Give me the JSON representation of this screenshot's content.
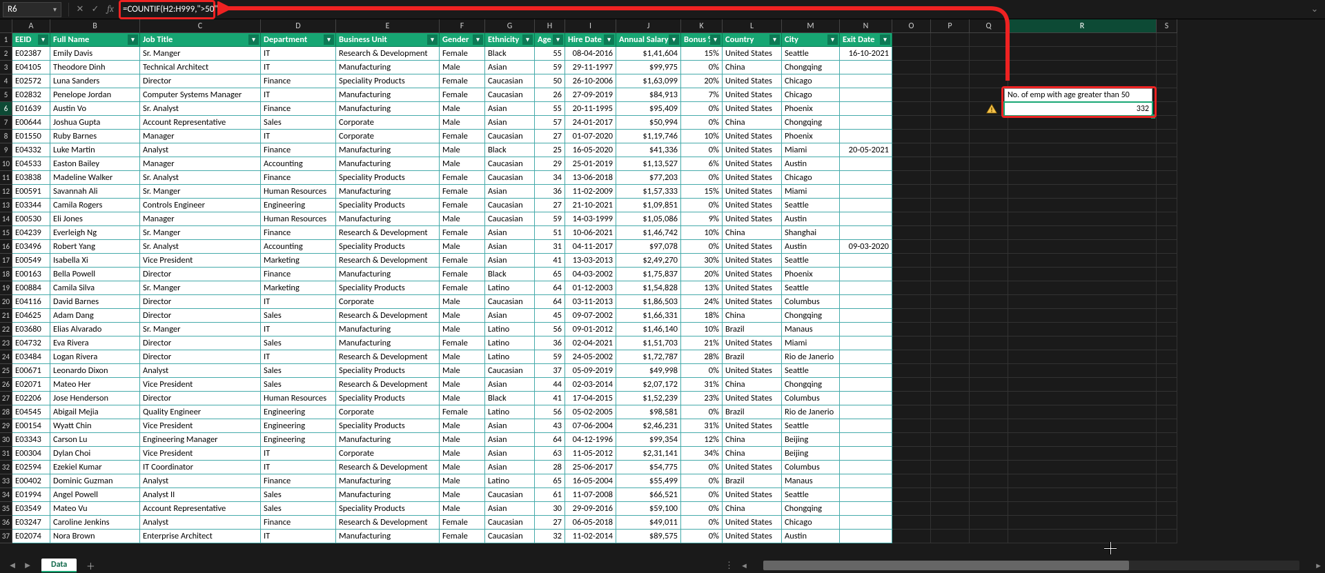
{
  "nameBox": "R6",
  "formula": "=COUNTIF(H2:H999,\">50\")",
  "chart_data": null,
  "columns": [
    "A",
    "B",
    "C",
    "D",
    "E",
    "F",
    "G",
    "H",
    "I",
    "J",
    "K",
    "L",
    "M",
    "N",
    "O",
    "P",
    "Q",
    "R",
    "S"
  ],
  "headers": [
    "EEID",
    "Full Name",
    "Job Title",
    "Department",
    "Business Unit",
    "Gender",
    "Ethnicity",
    "Age",
    "Hire Date",
    "Annual Salary",
    "Bonus %",
    "Country",
    "City",
    "Exit Date"
  ],
  "sideLabel": "No. of emp with age greater than 50",
  "sideResult": "332",
  "sheetTab": "Data",
  "rows": [
    {
      "n": 2,
      "d": [
        "E02387",
        "Emily Davis",
        "Sr. Manger",
        "IT",
        "Research & Development",
        "Female",
        "Black",
        "55",
        "08-04-2016",
        "$1,41,604",
        "15%",
        "United States",
        "Seattle",
        "16-10-2021"
      ]
    },
    {
      "n": 3,
      "d": [
        "E04105",
        "Theodore Dinh",
        "Technical Architect",
        "IT",
        "Manufacturing",
        "Male",
        "Asian",
        "59",
        "29-11-1997",
        "$99,975",
        "0%",
        "China",
        "Chongqing",
        ""
      ]
    },
    {
      "n": 4,
      "d": [
        "E02572",
        "Luna Sanders",
        "Director",
        "Finance",
        "Speciality Products",
        "Female",
        "Caucasian",
        "50",
        "26-10-2006",
        "$1,63,099",
        "20%",
        "United States",
        "Chicago",
        ""
      ]
    },
    {
      "n": 5,
      "d": [
        "E02832",
        "Penelope Jordan",
        "Computer Systems Manager",
        "IT",
        "Manufacturing",
        "Female",
        "Caucasian",
        "26",
        "27-09-2019",
        "$84,913",
        "7%",
        "United States",
        "Chicago",
        ""
      ]
    },
    {
      "n": 6,
      "d": [
        "E01639",
        "Austin Vo",
        "Sr. Analyst",
        "Finance",
        "Manufacturing",
        "Male",
        "Asian",
        "55",
        "20-11-1995",
        "$95,409",
        "0%",
        "United States",
        "Phoenix",
        ""
      ]
    },
    {
      "n": 7,
      "d": [
        "E00644",
        "Joshua Gupta",
        "Account Representative",
        "Sales",
        "Corporate",
        "Male",
        "Asian",
        "57",
        "24-01-2017",
        "$50,994",
        "0%",
        "China",
        "Chongqing",
        ""
      ]
    },
    {
      "n": 8,
      "d": [
        "E01550",
        "Ruby Barnes",
        "Manager",
        "IT",
        "Corporate",
        "Female",
        "Caucasian",
        "27",
        "01-07-2020",
        "$1,19,746",
        "10%",
        "United States",
        "Phoenix",
        ""
      ]
    },
    {
      "n": 9,
      "d": [
        "E04332",
        "Luke Martin",
        "Analyst",
        "Finance",
        "Manufacturing",
        "Male",
        "Black",
        "25",
        "16-05-2020",
        "$41,336",
        "0%",
        "United States",
        "Miami",
        "20-05-2021"
      ]
    },
    {
      "n": 10,
      "d": [
        "E04533",
        "Easton Bailey",
        "Manager",
        "Accounting",
        "Manufacturing",
        "Male",
        "Caucasian",
        "29",
        "25-01-2019",
        "$1,13,527",
        "6%",
        "United States",
        "Austin",
        ""
      ]
    },
    {
      "n": 11,
      "d": [
        "E03838",
        "Madeline Walker",
        "Sr. Analyst",
        "Finance",
        "Speciality Products",
        "Female",
        "Caucasian",
        "34",
        "13-06-2018",
        "$77,203",
        "0%",
        "United States",
        "Chicago",
        ""
      ]
    },
    {
      "n": 12,
      "d": [
        "E00591",
        "Savannah Ali",
        "Sr. Manger",
        "Human Resources",
        "Manufacturing",
        "Female",
        "Asian",
        "36",
        "11-02-2009",
        "$1,57,333",
        "15%",
        "United States",
        "Miami",
        ""
      ]
    },
    {
      "n": 13,
      "d": [
        "E03344",
        "Camila Rogers",
        "Controls Engineer",
        "Engineering",
        "Speciality Products",
        "Female",
        "Caucasian",
        "27",
        "21-10-2021",
        "$1,09,851",
        "0%",
        "United States",
        "Seattle",
        ""
      ]
    },
    {
      "n": 14,
      "d": [
        "E00530",
        "Eli Jones",
        "Manager",
        "Human Resources",
        "Manufacturing",
        "Male",
        "Caucasian",
        "59",
        "14-03-1999",
        "$1,05,086",
        "9%",
        "United States",
        "Austin",
        ""
      ]
    },
    {
      "n": 15,
      "d": [
        "E04239",
        "Everleigh Ng",
        "Sr. Manger",
        "Finance",
        "Research & Development",
        "Female",
        "Asian",
        "51",
        "10-06-2021",
        "$1,46,742",
        "10%",
        "China",
        "Shanghai",
        ""
      ]
    },
    {
      "n": 16,
      "d": [
        "E03496",
        "Robert Yang",
        "Sr. Analyst",
        "Accounting",
        "Speciality Products",
        "Male",
        "Asian",
        "31",
        "04-11-2017",
        "$97,078",
        "0%",
        "United States",
        "Austin",
        "09-03-2020"
      ]
    },
    {
      "n": 17,
      "d": [
        "E00549",
        "Isabella Xi",
        "Vice President",
        "Marketing",
        "Research & Development",
        "Female",
        "Asian",
        "41",
        "13-03-2013",
        "$2,49,270",
        "30%",
        "United States",
        "Seattle",
        ""
      ]
    },
    {
      "n": 18,
      "d": [
        "E00163",
        "Bella Powell",
        "Director",
        "Finance",
        "Manufacturing",
        "Female",
        "Black",
        "65",
        "04-03-2002",
        "$1,75,837",
        "20%",
        "United States",
        "Phoenix",
        ""
      ]
    },
    {
      "n": 19,
      "d": [
        "E00884",
        "Camila Silva",
        "Sr. Manger",
        "Marketing",
        "Speciality Products",
        "Female",
        "Latino",
        "64",
        "01-12-2003",
        "$1,54,828",
        "13%",
        "United States",
        "Seattle",
        ""
      ]
    },
    {
      "n": 20,
      "d": [
        "E04116",
        "David Barnes",
        "Director",
        "IT",
        "Corporate",
        "Male",
        "Caucasian",
        "64",
        "03-11-2013",
        "$1,86,503",
        "24%",
        "United States",
        "Columbus",
        ""
      ]
    },
    {
      "n": 21,
      "d": [
        "E04625",
        "Adam Dang",
        "Director",
        "Sales",
        "Research & Development",
        "Male",
        "Asian",
        "45",
        "09-07-2002",
        "$1,66,331",
        "18%",
        "China",
        "Chongqing",
        ""
      ]
    },
    {
      "n": 22,
      "d": [
        "E03680",
        "Elias Alvarado",
        "Sr. Manger",
        "IT",
        "Manufacturing",
        "Male",
        "Latino",
        "56",
        "09-01-2012",
        "$1,46,140",
        "10%",
        "Brazil",
        "Manaus",
        ""
      ]
    },
    {
      "n": 23,
      "d": [
        "E04732",
        "Eva Rivera",
        "Director",
        "Sales",
        "Manufacturing",
        "Female",
        "Latino",
        "36",
        "02-04-2021",
        "$1,51,703",
        "21%",
        "United States",
        "Miami",
        ""
      ]
    },
    {
      "n": 24,
      "d": [
        "E03484",
        "Logan Rivera",
        "Director",
        "IT",
        "Research & Development",
        "Male",
        "Latino",
        "59",
        "24-05-2002",
        "$1,72,787",
        "28%",
        "Brazil",
        "Rio de Janerio",
        ""
      ]
    },
    {
      "n": 25,
      "d": [
        "E00671",
        "Leonardo Dixon",
        "Analyst",
        "Sales",
        "Speciality Products",
        "Male",
        "Caucasian",
        "37",
        "05-09-2019",
        "$49,998",
        "0%",
        "United States",
        "Seattle",
        ""
      ]
    },
    {
      "n": 26,
      "d": [
        "E02071",
        "Mateo Her",
        "Vice President",
        "Sales",
        "Research & Development",
        "Male",
        "Asian",
        "44",
        "02-03-2014",
        "$2,07,172",
        "31%",
        "China",
        "Chongqing",
        ""
      ]
    },
    {
      "n": 27,
      "d": [
        "E02206",
        "Jose Henderson",
        "Director",
        "Human Resources",
        "Speciality Products",
        "Male",
        "Black",
        "41",
        "17-04-2015",
        "$1,52,239",
        "23%",
        "United States",
        "Columbus",
        ""
      ]
    },
    {
      "n": 28,
      "d": [
        "E04545",
        "Abigail Mejia",
        "Quality Engineer",
        "Engineering",
        "Corporate",
        "Female",
        "Latino",
        "56",
        "05-02-2005",
        "$98,581",
        "0%",
        "Brazil",
        "Rio de Janerio",
        ""
      ]
    },
    {
      "n": 29,
      "d": [
        "E00154",
        "Wyatt Chin",
        "Vice President",
        "Engineering",
        "Speciality Products",
        "Male",
        "Asian",
        "43",
        "07-06-2004",
        "$2,46,231",
        "31%",
        "United States",
        "Seattle",
        ""
      ]
    },
    {
      "n": 30,
      "d": [
        "E03343",
        "Carson Lu",
        "Engineering Manager",
        "Engineering",
        "Manufacturing",
        "Male",
        "Asian",
        "64",
        "04-12-1996",
        "$99,354",
        "12%",
        "China",
        "Beijing",
        ""
      ]
    },
    {
      "n": 31,
      "d": [
        "E00304",
        "Dylan Choi",
        "Vice President",
        "IT",
        "Corporate",
        "Male",
        "Asian",
        "63",
        "11-05-2012",
        "$2,31,141",
        "34%",
        "China",
        "Beijing",
        ""
      ]
    },
    {
      "n": 32,
      "d": [
        "E02594",
        "Ezekiel Kumar",
        "IT Coordinator",
        "IT",
        "Research & Development",
        "Male",
        "Asian",
        "28",
        "25-06-2017",
        "$54,775",
        "0%",
        "United States",
        "Columbus",
        ""
      ]
    },
    {
      "n": 33,
      "d": [
        "E00402",
        "Dominic Guzman",
        "Analyst",
        "Finance",
        "Manufacturing",
        "Male",
        "Latino",
        "65",
        "16-05-2004",
        "$55,499",
        "0%",
        "Brazil",
        "Manaus",
        ""
      ]
    },
    {
      "n": 34,
      "d": [
        "E01994",
        "Angel Powell",
        "Analyst II",
        "Sales",
        "Manufacturing",
        "Male",
        "Caucasian",
        "61",
        "11-07-2008",
        "$66,521",
        "0%",
        "United States",
        "Seattle",
        ""
      ]
    },
    {
      "n": 35,
      "d": [
        "E03549",
        "Mateo Vu",
        "Account Representative",
        "Sales",
        "Speciality Products",
        "Male",
        "Asian",
        "30",
        "29-09-2016",
        "$59,100",
        "0%",
        "China",
        "Chongqing",
        ""
      ]
    },
    {
      "n": 36,
      "d": [
        "E03247",
        "Caroline Jenkins",
        "Analyst",
        "Finance",
        "Research & Development",
        "Female",
        "Caucasian",
        "27",
        "06-05-2018",
        "$49,011",
        "0%",
        "United States",
        "Chicago",
        ""
      ]
    },
    {
      "n": 37,
      "d": [
        "E02074",
        "Nora Brown",
        "Enterprise Architect",
        "IT",
        "Manufacturing",
        "Female",
        "Caucasian",
        "32",
        "11-02-2014",
        "$89,575",
        "0%",
        "United States",
        "Austin",
        ""
      ]
    }
  ]
}
